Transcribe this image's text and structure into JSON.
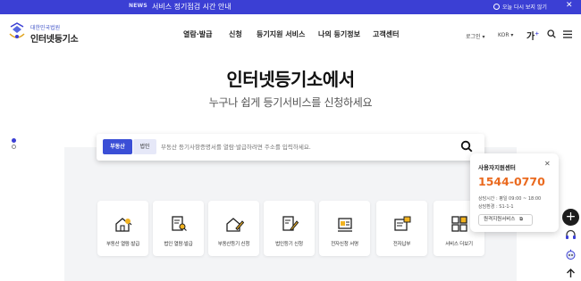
{
  "notice": {
    "tag": "NEWS",
    "text": "서비스 정기점검 시간 안내",
    "hide_today": "오늘 다시 보지 않기",
    "close_icon": "close-icon"
  },
  "header": {
    "logo_small": "대한민국법원",
    "logo_main": "인터넷등기소",
    "nav": [
      "열람·발급",
      "신청",
      "등기지원 서비스",
      "나의 등기정보",
      "고객센터"
    ],
    "login": "로그인 ▾",
    "lang": "KOR ▾",
    "font_size_label": "가",
    "font_size_mark": "+",
    "search_icon": "search-icon",
    "menu_icon": "menu-icon"
  },
  "hero": {
    "title": "인터넷등기소에서",
    "subtitle": "누구나 쉽게 등기서비스를 신청하세요"
  },
  "search": {
    "tabs": [
      "부동산",
      "법인"
    ],
    "active_tab": "부동산",
    "placeholder": "부동산 등기사항증명서를 열람·발급하려면 주소를 입력하세요.",
    "search_icon": "search-icon"
  },
  "quick_cards": [
    {
      "label": "부동산 열람·발급",
      "icon": "house-search-icon"
    },
    {
      "label": "법인 열람·발급",
      "icon": "document-search-icon"
    },
    {
      "label": "부동산등기 신청",
      "icon": "house-pen-icon"
    },
    {
      "label": "법인등기 신청",
      "icon": "document-pen-icon"
    },
    {
      "label": "전자신청 서명",
      "icon": "e-sign-icon"
    },
    {
      "label": "전자납부",
      "icon": "e-payment-icon"
    },
    {
      "label": "서비스 더보기",
      "icon": "grid-icon"
    }
  ],
  "support": {
    "title": "사용자지원센터",
    "phone": "1544-0770",
    "hours": "상담시간 : 평일 09:00 ~ 18:00",
    "env": "상담환경 : S1-1-1",
    "remote_button": "원격지원서비스"
  },
  "colors": {
    "brand": "#3b3fd4",
    "accent": "#ea6a1f",
    "panel": "#f3f4f6"
  }
}
